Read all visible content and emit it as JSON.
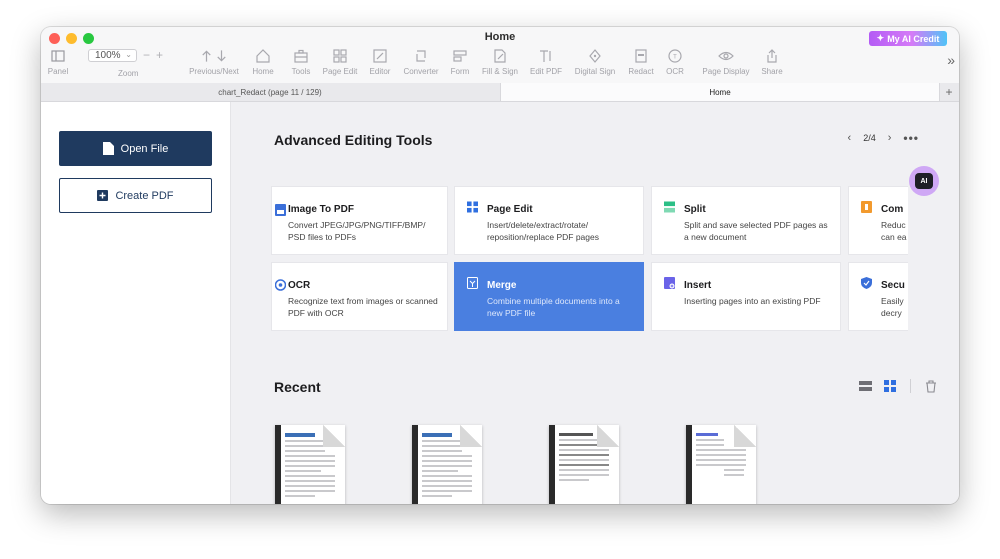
{
  "window": {
    "title": "Home",
    "ai_credit": "My AI Credit"
  },
  "toolbar": {
    "panel": "Panel",
    "zoom_value": "100%",
    "zoom_label": "Zoom",
    "items": [
      {
        "label": "Previous/Next",
        "icon": "arrow-up-down-icon"
      },
      {
        "label": "Home",
        "icon": "home-icon"
      },
      {
        "label": "Tools",
        "icon": "toolbox-icon"
      },
      {
        "label": "Page Edit",
        "icon": "grid-icon"
      },
      {
        "label": "Editor",
        "icon": "edit-icon"
      },
      {
        "label": "Converter",
        "icon": "converter-icon"
      },
      {
        "label": "Form",
        "icon": "form-icon"
      },
      {
        "label": "Fill & Sign",
        "icon": "fill-sign-icon"
      },
      {
        "label": "Edit PDF",
        "icon": "text-cursor-icon"
      },
      {
        "label": "Digital Sign",
        "icon": "pen-nib-icon"
      },
      {
        "label": "Redact",
        "icon": "redact-icon"
      },
      {
        "label": "OCR",
        "icon": "ocr-icon"
      },
      {
        "label": "Page Display",
        "icon": "eye-icon"
      },
      {
        "label": "Share",
        "icon": "share-icon"
      }
    ]
  },
  "tabs": {
    "doc": "chart_Redact (page 11 / 129)",
    "home": "Home",
    "add": "+"
  },
  "sidebar": {
    "open_file": "Open File",
    "create_pdf": "Create PDF"
  },
  "tools_section": {
    "title": "Advanced Editing Tools",
    "page_indicator": "2/4",
    "cards": [
      {
        "title": "Image To PDF",
        "desc": "Convert JPEG/JPG/PNG/TIFF/BMP/ PSD files to PDFs",
        "icon": "image-pdf-icon",
        "color": "#3b6fd9"
      },
      {
        "title": "Page Edit",
        "desc": "Insert/delete/extract/rotate/ reposition/replace PDF pages",
        "icon": "page-edit-icon",
        "color": "#2f6fe0"
      },
      {
        "title": "Split",
        "desc": "Split and save selected PDF pages as a new document",
        "icon": "split-icon",
        "color": "#2bbf86"
      },
      {
        "title": "Com",
        "desc": "Reduc can ea",
        "icon": "compress-icon",
        "color": "#f29a2e"
      },
      {
        "title": "OCR",
        "desc": "Recognize text from images or scanned PDF with OCR",
        "icon": "ocr-icon",
        "color": "#3b6fd9"
      },
      {
        "title": "Merge",
        "desc": "Combine multiple documents into a new PDF file",
        "icon": "merge-icon",
        "color": "#ffffff"
      },
      {
        "title": "Insert",
        "desc": "Inserting pages into an existing PDF",
        "icon": "insert-icon",
        "color": "#6a63e8"
      },
      {
        "title": "Secu",
        "desc": "Easily decry",
        "icon": "shield-icon",
        "color": "#3b6fd9"
      }
    ]
  },
  "recent_section": {
    "title": "Recent"
  },
  "ai_assistant": {
    "label": "AI"
  }
}
